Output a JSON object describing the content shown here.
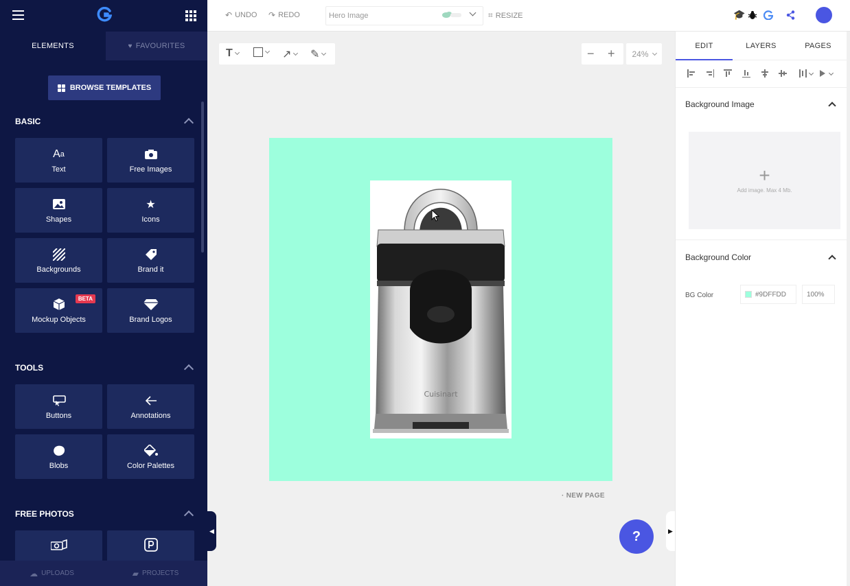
{
  "sidebar": {
    "tabs": [
      {
        "label": "ELEMENTS"
      },
      {
        "label": "FAVOURITES"
      }
    ],
    "browse_templates": "BROWSE TEMPLATES",
    "sections": {
      "basic": {
        "title": "BASIC",
        "items": [
          {
            "label": "Text",
            "icon": "text-icon"
          },
          {
            "label": "Free Images",
            "icon": "camera-icon"
          },
          {
            "label": "Shapes",
            "icon": "image-icon"
          },
          {
            "label": "Icons",
            "icon": "star-icon"
          },
          {
            "label": "Backgrounds",
            "icon": "stripes-icon"
          },
          {
            "label": "Brand it",
            "icon": "tag-icon"
          },
          {
            "label": "Mockup Objects",
            "icon": "cube-icon",
            "badge": "BETA"
          },
          {
            "label": "Brand Logos",
            "icon": "diamond-icon"
          }
        ]
      },
      "tools": {
        "title": "TOOLS",
        "items": [
          {
            "label": "Buttons",
            "icon": "cursor-click-icon"
          },
          {
            "label": "Annotations",
            "icon": "arrow-left-icon"
          },
          {
            "label": "Blobs",
            "icon": "blob-icon"
          },
          {
            "label": "Color Palettes",
            "icon": "paint-bucket-icon"
          }
        ]
      },
      "free_photos": {
        "title": "FREE PHOTOS",
        "items": [
          {
            "label": "",
            "icon": "photo-camera-icon"
          },
          {
            "label": "",
            "icon": "pexels-icon"
          }
        ]
      }
    },
    "bottom": {
      "uploads": "UPLOADS",
      "projects": "PROJECTS"
    }
  },
  "topbar": {
    "undo": "UNDO",
    "redo": "REDO",
    "title_value": "Hero Image",
    "resize": "RESIZE"
  },
  "canvas": {
    "zoom": "24%",
    "new_page": "NEW PAGE",
    "background_color": "#9DFFDD",
    "help": "?",
    "product_brand_text": "Cuisinart"
  },
  "right_panel": {
    "tabs": [
      {
        "label": "EDIT"
      },
      {
        "label": "LAYERS"
      },
      {
        "label": "PAGES"
      }
    ],
    "background_image": {
      "title": "Background Image",
      "hint": "Add image. Max 4 Mb."
    },
    "background_color": {
      "title": "Background Color",
      "label": "BG Color",
      "value": "#9DFFDD",
      "opacity": "100%"
    }
  },
  "colors": {
    "sidebar_bg": "#0e1744",
    "tile_bg": "#1d2a5e",
    "accent": "#4a56e2",
    "beta": "#e53950"
  }
}
